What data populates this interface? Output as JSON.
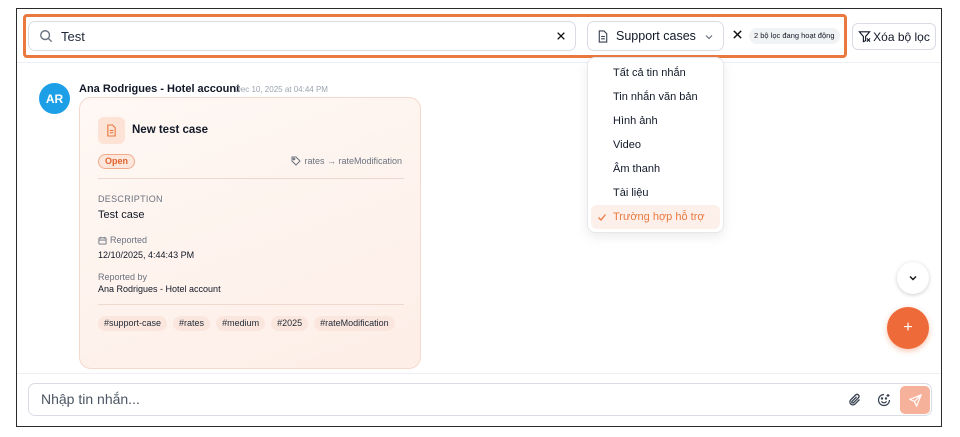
{
  "search": {
    "value": "Test",
    "placeholder": ""
  },
  "filter": {
    "selected_type": "Support cases",
    "active_badge": "2 bộ lọc đang hoạt động",
    "clear_label": "Xóa bộ lọc"
  },
  "dropdown": {
    "items": [
      {
        "label": "Tất cả tin nhắn",
        "selected": false
      },
      {
        "label": "Tin nhắn văn bản",
        "selected": false
      },
      {
        "label": "Hình ảnh",
        "selected": false
      },
      {
        "label": "Video",
        "selected": false
      },
      {
        "label": "Âm thanh",
        "selected": false
      },
      {
        "label": "Tài liệu",
        "selected": false
      },
      {
        "label": "Trường hợp hỗ trợ",
        "selected": true
      }
    ]
  },
  "message": {
    "avatar_initials": "AR",
    "avatar_color": "#1d9fe8",
    "sender": "Ana Rodrigues - Hotel account",
    "timestamp": "Dec 10, 2025 at 04:44 PM",
    "card": {
      "title": "New test case",
      "status": "Open",
      "tag_flow": "rates → rateModification",
      "description_label": "DESCRIPTION",
      "description": "Test case",
      "reported_label": "Reported",
      "reported_value": "12/10/2025, 4:44:43 PM",
      "reported_by_label": "Reported by",
      "reported_by_value": "Ana Rodrigues - Hotel account",
      "hashtags": [
        "#support-case",
        "#rates",
        "#medium",
        "#2025",
        "#rateModification"
      ]
    }
  },
  "composer": {
    "placeholder": "Nhập tin nhắn..."
  },
  "fab_label": "+",
  "colors": {
    "accent": "#e9793f",
    "fab": "#ee6a38",
    "send_disabled": "#f5b19a"
  }
}
